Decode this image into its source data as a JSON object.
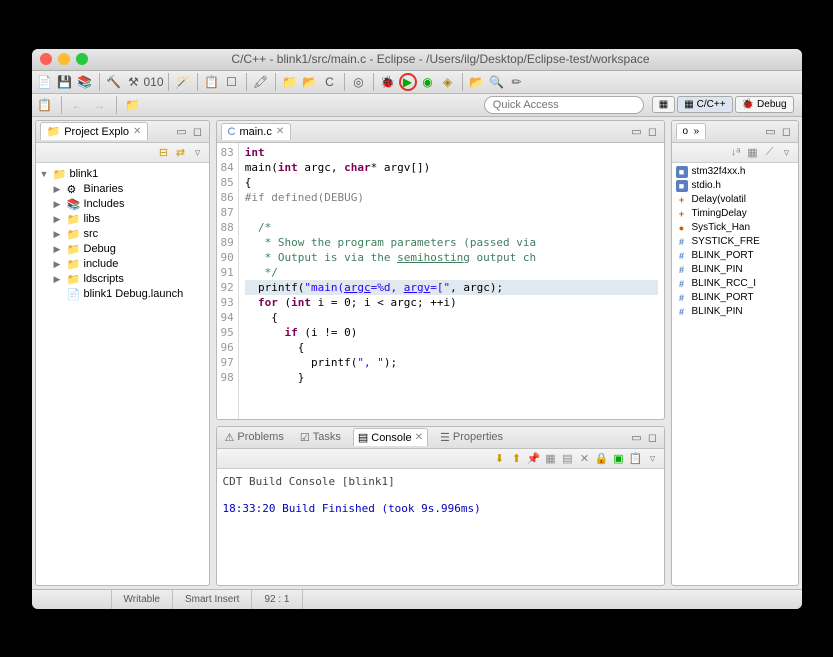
{
  "title": "C/C++ - blink1/src/main.c - Eclipse - /Users/ilg/Desktop/Eclipse-test/workspace",
  "quickAccess": {
    "placeholder": "Quick Access"
  },
  "perspectives": {
    "cpp": "C/C++",
    "debug": "Debug"
  },
  "projectExplorer": {
    "title": "Project Explo",
    "items": [
      {
        "label": "blink1",
        "icon": "📁",
        "indent": 1,
        "arrow": "▼"
      },
      {
        "label": "Binaries",
        "icon": "⚙",
        "indent": 2,
        "arrow": "▶"
      },
      {
        "label": "Includes",
        "icon": "📚",
        "indent": 2,
        "arrow": "▶"
      },
      {
        "label": "libs",
        "icon": "📁",
        "indent": 2,
        "arrow": "▶"
      },
      {
        "label": "src",
        "icon": "📁",
        "indent": 2,
        "arrow": "▶"
      },
      {
        "label": "Debug",
        "icon": "📁",
        "indent": 2,
        "arrow": "▶"
      },
      {
        "label": "include",
        "icon": "📁",
        "indent": 2,
        "arrow": "▶"
      },
      {
        "label": "ldscripts",
        "icon": "📁",
        "indent": 2,
        "arrow": "▶"
      },
      {
        "label": "blink1 Debug.launch",
        "icon": "📄",
        "indent": 2,
        "arrow": ""
      }
    ]
  },
  "editor": {
    "filename": "main.c",
    "lines": [
      {
        "n": 83,
        "html": "<span class='kw'>int</span>"
      },
      {
        "n": 84,
        "html": "<span class='fn'>main</span>(<span class='kw'>int</span> argc, <span class='kw'>char</span>* argv[])"
      },
      {
        "n": 85,
        "html": "{"
      },
      {
        "n": 86,
        "html": "<span class='pp'>#if defined(DEBUG)</span>"
      },
      {
        "n": 87,
        "html": ""
      },
      {
        "n": 88,
        "html": "  <span class='cm'>/*</span>"
      },
      {
        "n": 89,
        "html": "   <span class='cm'>* Show the program parameters (passed via</span>"
      },
      {
        "n": 90,
        "html": "   <span class='cm'>* Output is via the <u>semihosting</u> output ch</span>"
      },
      {
        "n": 91,
        "html": "   <span class='cm'>*/</span>"
      },
      {
        "n": 92,
        "html": "  <span class='fn'>printf</span>(<span class='str'>\"main(<u>argc</u>=%d, <u>argv</u>=[\"</span>, argc);",
        "hl": true
      },
      {
        "n": 93,
        "html": "  <span class='kw'>for</span> (<span class='kw'>int</span> i = 0; i &lt; argc; ++i)"
      },
      {
        "n": 94,
        "html": "    {"
      },
      {
        "n": 95,
        "html": "      <span class='kw'>if</span> (i != 0)"
      },
      {
        "n": 96,
        "html": "        {"
      },
      {
        "n": 97,
        "html": "          <span class='fn'>printf</span>(<span class='str'>\", \"</span>);"
      },
      {
        "n": 98,
        "html": "        }"
      }
    ]
  },
  "outline": {
    "items": [
      {
        "label": "stm32f4xx.h",
        "ic": "inc",
        "sym": "■"
      },
      {
        "label": "stdio.h",
        "ic": "inc",
        "sym": "■"
      },
      {
        "label": "Delay(volatil",
        "ic": "fn",
        "sym": "+"
      },
      {
        "label": "TimingDelay",
        "ic": "fn",
        "sym": "+"
      },
      {
        "label": "SysTick_Han",
        "ic": "fn",
        "sym": "●"
      },
      {
        "label": "SYSTICK_FRE",
        "ic": "def",
        "sym": "#"
      },
      {
        "label": "BLINK_PORT",
        "ic": "def",
        "sym": "#"
      },
      {
        "label": "BLINK_PIN",
        "ic": "def",
        "sym": "#"
      },
      {
        "label": "BLINK_RCC_I",
        "ic": "def",
        "sym": "#"
      },
      {
        "label": "BLINK_PORT",
        "ic": "def",
        "sym": "#"
      },
      {
        "label": "BLINK_PIN",
        "ic": "def",
        "sym": "#"
      }
    ]
  },
  "bottomTabs": {
    "problems": "Problems",
    "tasks": "Tasks",
    "console": "Console",
    "properties": "Properties"
  },
  "console": {
    "label": "CDT Build Console [blink1]",
    "message": "18:33:20 Build Finished (took 9s.996ms)"
  },
  "status": {
    "writable": "Writable",
    "insert": "Smart Insert",
    "pos": "92 : 1"
  }
}
